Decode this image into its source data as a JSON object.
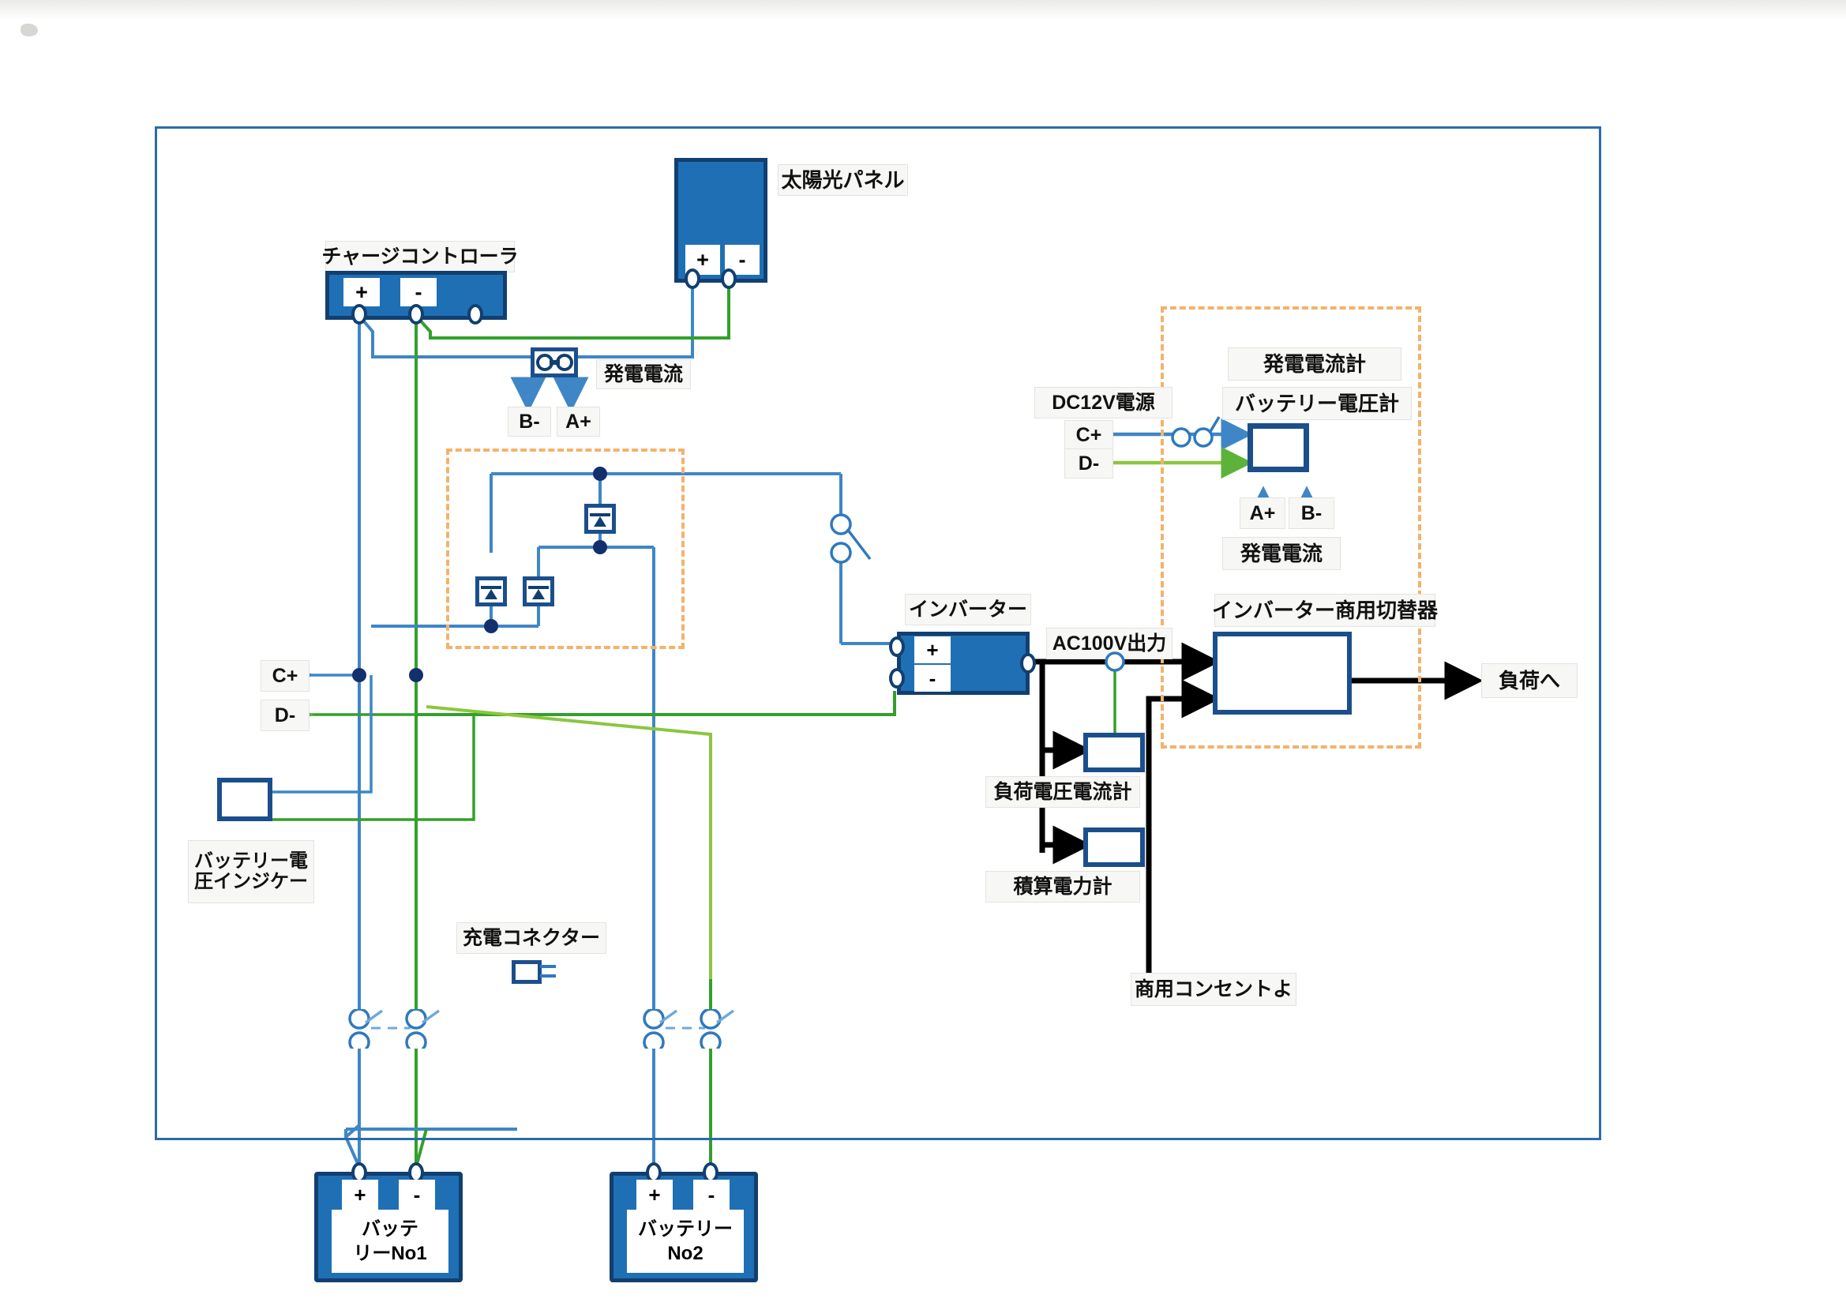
{
  "diagram": {
    "title_present": false,
    "colors": {
      "frame_border": "#2b6ca8",
      "device_blue": "#1f6fb5",
      "device_border": "#113f70",
      "wire_blue": "#3f86c6",
      "wire_green": "#33a02c",
      "wire_lightgreen": "#8cc63f",
      "wire_black": "#000000",
      "dashed_orange": "#f4b26a",
      "label_bg": "#f7f7f5"
    },
    "labels": {
      "solar_panel": "太陽光パネル",
      "charge_controller": "チャージコントローラ",
      "generation_current_1": "発電電流",
      "generation_current_2": "発電電流",
      "generation_current_meter": "発電電流計",
      "battery_voltage_meter": "バッテリー電圧計",
      "dc12v_source": "DC12V電源",
      "inverter": "インバーター",
      "ac100v_output": "AC100V出力",
      "inverter_commercial_switcher": "インバーター商用切替器",
      "to_load": "負荷へ",
      "load_volt_amp_meter": "負荷電圧電流計",
      "watt_hour_meter": "積算電力計",
      "commercial_outlet_from": "商用コンセントよ",
      "battery_voltage_indicator": "バッテリー電\n圧インジケー",
      "battery_voltage_indicator_line1": "バッテリー電",
      "battery_voltage_indicator_line2": "圧インジケー",
      "charge_connector": "充電コネクター",
      "battery_no1_line1": "バッテ",
      "battery_no1_line2": "リーNo1",
      "battery_no2_line1": "バッテリー",
      "battery_no2_line2": "No2"
    },
    "terminals": {
      "plus": "+",
      "minus": "-",
      "a_plus": "A+",
      "b_minus": "B-",
      "c_plus": "C+",
      "d_minus": "D-"
    },
    "devices": [
      {
        "id": "solar-panel",
        "label": "太陽光パネル",
        "terminals": [
          "+",
          "-"
        ]
      },
      {
        "id": "charge-controller",
        "label": "チャージコントローラ",
        "terminals": [
          "+",
          "-"
        ]
      },
      {
        "id": "inverter",
        "label": "インバーター",
        "terminals": [
          "+",
          "-"
        ]
      },
      {
        "id": "battery-no1",
        "label": "バッテリーNo1",
        "terminals": [
          "+",
          "-"
        ]
      },
      {
        "id": "battery-no2",
        "label": "バッテリーNo2",
        "terminals": [
          "+",
          "-"
        ]
      },
      {
        "id": "current-sensor",
        "label": "発電電流",
        "terminals": [
          "B-",
          "A+"
        ]
      },
      {
        "id": "battery-volt-amp-meter",
        "label": "バッテリー電圧計",
        "terminals": [
          "A+",
          "B-",
          "C+",
          "D-"
        ]
      },
      {
        "id": "inverter-commercial-switcher",
        "label": "インバーター商用切替器",
        "terminals": []
      },
      {
        "id": "load-volt-amp-meter",
        "label": "負荷電圧電流計",
        "terminals": []
      },
      {
        "id": "watt-hour-meter",
        "label": "積算電力計",
        "terminals": []
      },
      {
        "id": "battery-voltage-indicator",
        "label": "バッテリー電圧インジケー",
        "terminals": []
      },
      {
        "id": "charge-connector",
        "label": "充電コネクター",
        "terminals": []
      }
    ]
  }
}
